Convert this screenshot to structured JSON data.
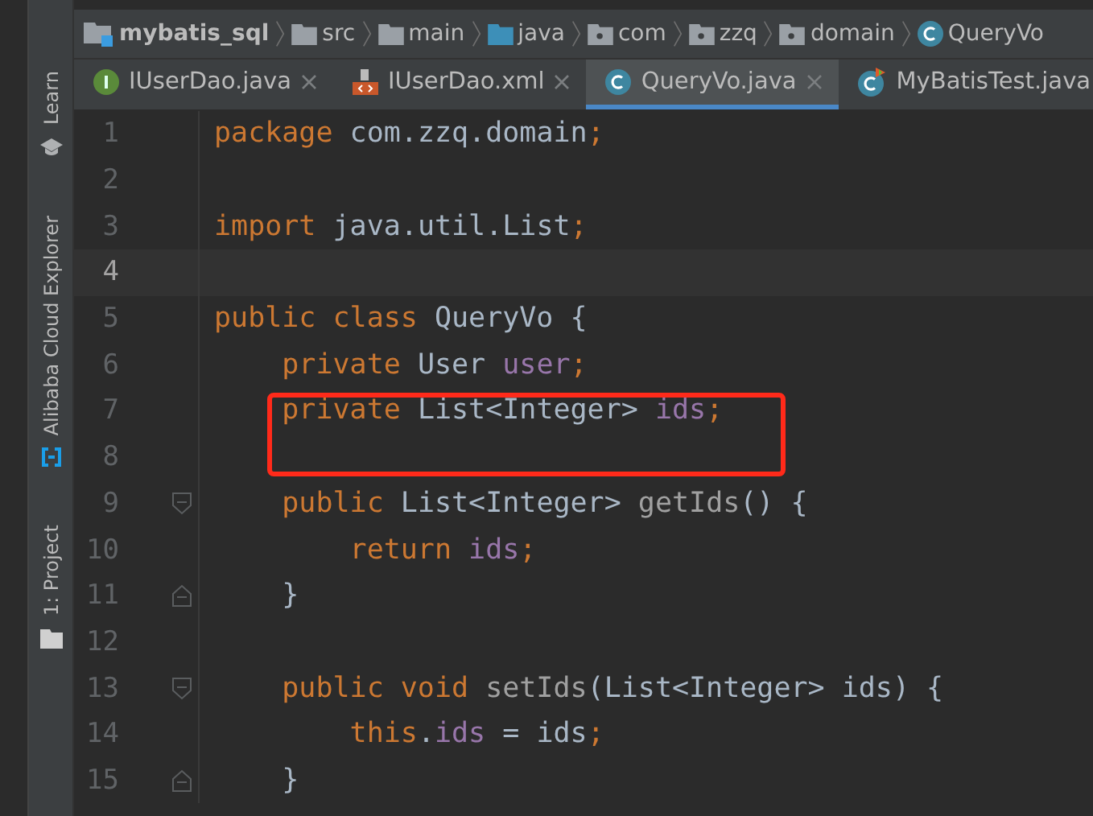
{
  "breadcrumb": [
    {
      "label": "mybatis_sql",
      "kind": "module"
    },
    {
      "label": "src",
      "kind": "folder"
    },
    {
      "label": "main",
      "kind": "folder"
    },
    {
      "label": "java",
      "kind": "source"
    },
    {
      "label": "com",
      "kind": "package"
    },
    {
      "label": "zzq",
      "kind": "package"
    },
    {
      "label": "domain",
      "kind": "package"
    },
    {
      "label": "QueryVo",
      "kind": "class"
    }
  ],
  "tabs": [
    {
      "label": "IUserDao.java",
      "kind": "interface",
      "selected": false,
      "closable": true
    },
    {
      "label": "IUserDao.xml",
      "kind": "xml",
      "selected": false,
      "closable": true
    },
    {
      "label": "QueryVo.java",
      "kind": "class",
      "selected": true,
      "closable": true
    },
    {
      "label": "MyBatisTest.java",
      "kind": "test",
      "selected": false,
      "closable": false
    }
  ],
  "tool_strip": [
    {
      "label": "Learn",
      "kind": "learn"
    },
    {
      "label": "Alibaba Cloud Explorer",
      "kind": "cloud"
    },
    {
      "label": "1: Project",
      "kind": "project"
    }
  ],
  "lines": [
    {
      "number": "1",
      "current": false,
      "fold_open": false,
      "fold_close": false,
      "boxed": false,
      "tokens": [
        {
          "text": "package ",
          "kind": "keyword"
        },
        {
          "text": "com.zzq.domain",
          "kind": "plain"
        },
        {
          "text": ";",
          "kind": "keyword"
        }
      ]
    },
    {
      "number": "2",
      "current": false,
      "fold_open": false,
      "fold_close": false,
      "boxed": false
    },
    {
      "number": "3",
      "current": false,
      "fold_open": false,
      "fold_close": false,
      "boxed": false,
      "tokens": [
        {
          "text": "import ",
          "kind": "keyword"
        },
        {
          "text": "java.util.List",
          "kind": "plain"
        },
        {
          "text": ";",
          "kind": "keyword"
        }
      ]
    },
    {
      "number": "4",
      "current": true,
      "fold_open": false,
      "fold_close": false,
      "boxed": false
    },
    {
      "number": "5",
      "current": false,
      "fold_open": false,
      "fold_close": false,
      "boxed": false,
      "tokens": [
        {
          "text": "public class ",
          "kind": "keyword"
        },
        {
          "text": "QueryVo {",
          "kind": "plain"
        }
      ]
    },
    {
      "number": "6",
      "current": false,
      "fold_open": false,
      "fold_close": false,
      "boxed": false,
      "tokens": [
        {
          "text": "    private ",
          "kind": "keyword"
        },
        {
          "text": "User ",
          "kind": "plain"
        },
        {
          "text": "user",
          "kind": "field"
        },
        {
          "text": ";",
          "kind": "keyword"
        }
      ]
    },
    {
      "number": "7",
      "current": false,
      "fold_open": false,
      "fold_close": false,
      "boxed": true,
      "tokens": [
        {
          "text": "    private ",
          "kind": "keyword"
        },
        {
          "text": "List<Integer> ",
          "kind": "plain"
        },
        {
          "text": "ids",
          "kind": "field"
        },
        {
          "text": ";",
          "kind": "keyword"
        }
      ]
    },
    {
      "number": "8",
      "current": false,
      "fold_open": false,
      "fold_close": false,
      "boxed": false
    },
    {
      "number": "9",
      "current": false,
      "fold_open": true,
      "fold_close": false,
      "boxed": false,
      "tokens": [
        {
          "text": "    public ",
          "kind": "keyword"
        },
        {
          "text": "List<Integer> ",
          "kind": "plain"
        },
        {
          "text": "getIds",
          "kind": "method"
        },
        {
          "text": "() {",
          "kind": "plain"
        }
      ]
    },
    {
      "number": "10",
      "current": false,
      "fold_open": false,
      "fold_close": false,
      "boxed": false,
      "tokens": [
        {
          "text": "        return ",
          "kind": "keyword"
        },
        {
          "text": "ids",
          "kind": "field"
        },
        {
          "text": ";",
          "kind": "keyword"
        }
      ]
    },
    {
      "number": "11",
      "current": false,
      "fold_open": false,
      "fold_close": true,
      "boxed": false,
      "tokens": [
        {
          "text": "    }",
          "kind": "plain"
        }
      ]
    },
    {
      "number": "12",
      "current": false,
      "fold_open": false,
      "fold_close": false,
      "boxed": false
    },
    {
      "number": "13",
      "current": false,
      "fold_open": true,
      "fold_close": false,
      "boxed": false,
      "tokens": [
        {
          "text": "    public void ",
          "kind": "keyword"
        },
        {
          "text": "setIds",
          "kind": "method"
        },
        {
          "text": "(List<Integer> ids) {",
          "kind": "plain"
        }
      ]
    },
    {
      "number": "14",
      "current": false,
      "fold_open": false,
      "fold_close": false,
      "boxed": false,
      "tokens": [
        {
          "text": "        this",
          "kind": "keyword"
        },
        {
          "text": ".",
          "kind": "plain"
        },
        {
          "text": "ids",
          "kind": "field"
        },
        {
          "text": " = ids",
          "kind": "plain"
        },
        {
          "text": ";",
          "kind": "keyword"
        }
      ]
    },
    {
      "number": "15",
      "current": false,
      "fold_open": false,
      "fold_close": true,
      "boxed": false,
      "tokens": [
        {
          "text": "    }",
          "kind": "plain"
        }
      ]
    }
  ]
}
